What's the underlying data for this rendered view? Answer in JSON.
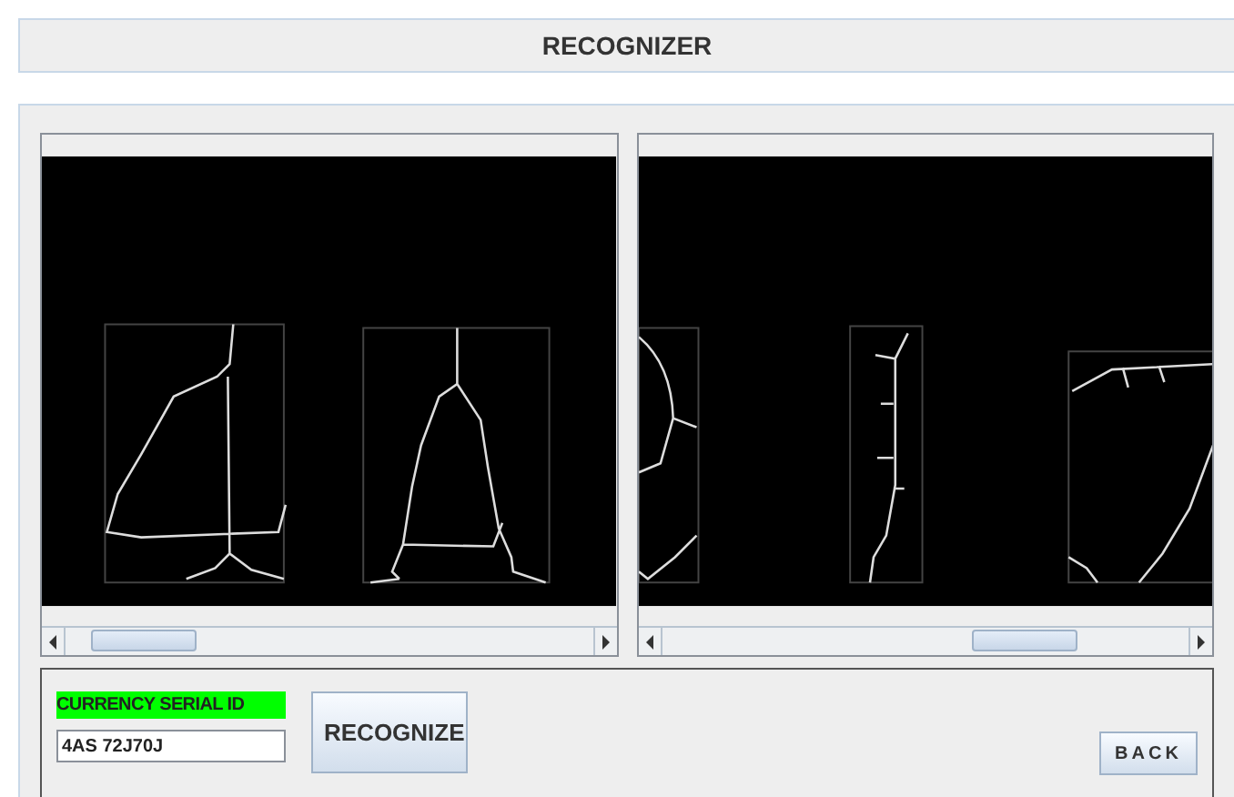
{
  "window": {
    "title": "RECOGNIZER"
  },
  "serial_field": {
    "label": "CURRENCY SERIAL ID",
    "value": "4AS 72J70J"
  },
  "buttons": [
    {
      "kind": "recognize",
      "label": "RECOGNIZE"
    },
    {
      "kind": "back",
      "label": "BACK"
    }
  ]
}
